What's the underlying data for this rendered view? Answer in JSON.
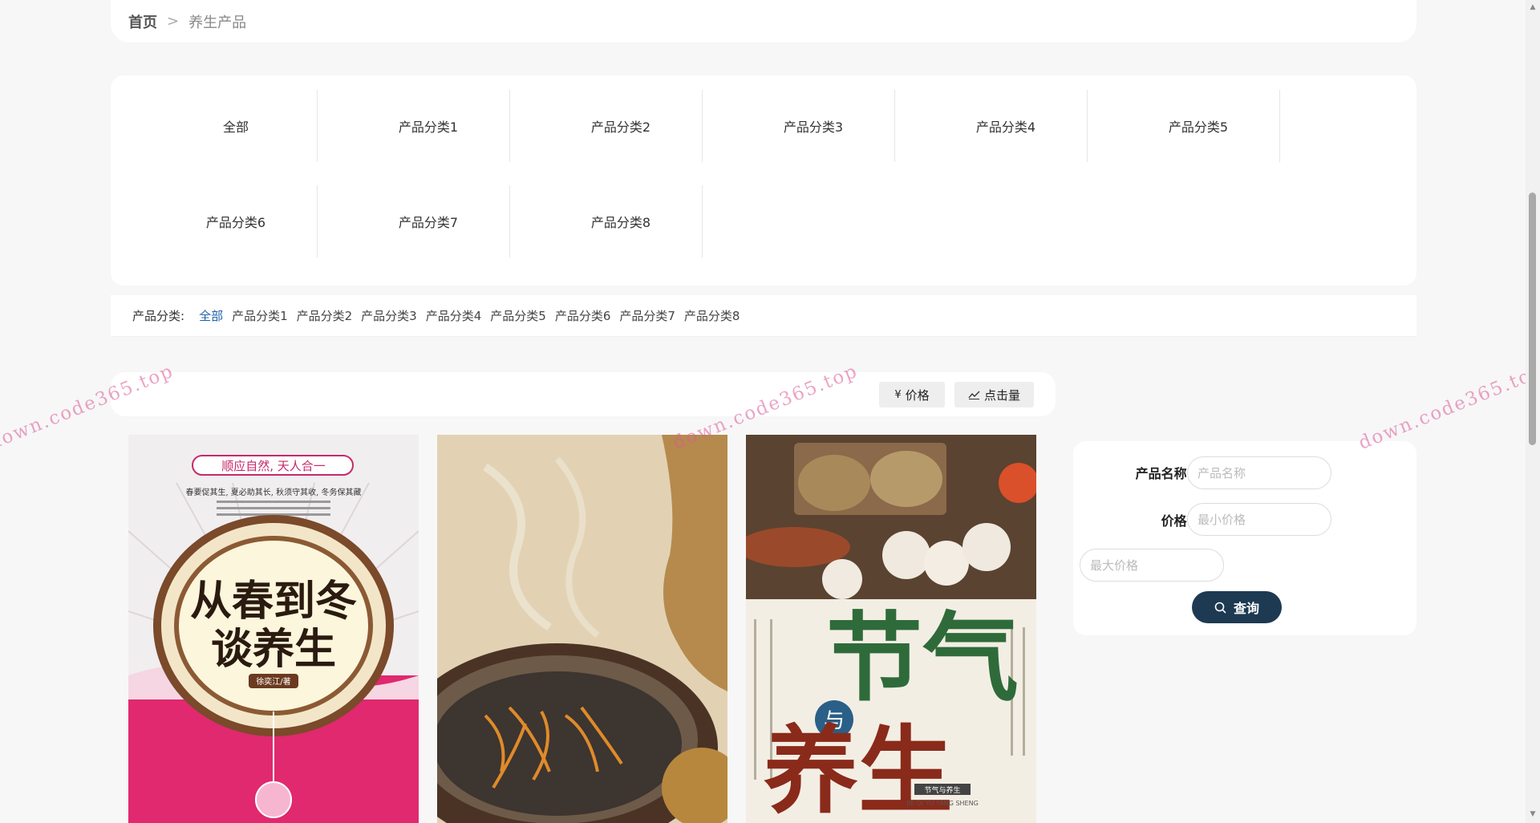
{
  "breadcrumb": {
    "home": "首页",
    "separator": ">",
    "current": "养生产品"
  },
  "category_grid": [
    "全部",
    "产品分类1",
    "产品分类2",
    "产品分类3",
    "产品分类4",
    "产品分类5",
    "产品分类6",
    "产品分类7",
    "产品分类8"
  ],
  "filter": {
    "label": "产品分类:",
    "options": [
      "全部",
      "产品分类1",
      "产品分类2",
      "产品分类3",
      "产品分类4",
      "产品分类5",
      "产品分类6",
      "产品分类7",
      "产品分类8"
    ],
    "active": "全部"
  },
  "sort": {
    "price": {
      "icon": "¥",
      "label": "价格"
    },
    "clicks": {
      "icon": "trend-icon",
      "label": "点击量"
    }
  },
  "products": [
    {
      "image": "cover-four-seasons",
      "cover_title": [
        "从春到冬",
        "谈养生"
      ],
      "banner": "顺应自然, 天人合一",
      "subtitle": "春要促其生, 夏必助其长, 秋须守其收, 冬务保其藏",
      "author": "徐奕江/著"
    },
    {
      "image": "cordyceps-soup"
    },
    {
      "image": "solar-terms-cover",
      "cover_title": [
        "节气",
        "与",
        "养生"
      ],
      "caption": "节气与养生",
      "pinyin": "JIE QI YU YANG SHENG"
    }
  ],
  "search": {
    "name_label": "产品名称:",
    "name_placeholder": "产品名称",
    "price_label": "价格:",
    "min_placeholder": "最小价格",
    "max_placeholder": "最大价格",
    "button_label": "查询"
  },
  "watermark": "down.code365.top",
  "colors": {
    "accent": "#1e63a8",
    "button": "#1d3a52",
    "background": "#f7f7f7",
    "watermark": "#dc5a96"
  }
}
